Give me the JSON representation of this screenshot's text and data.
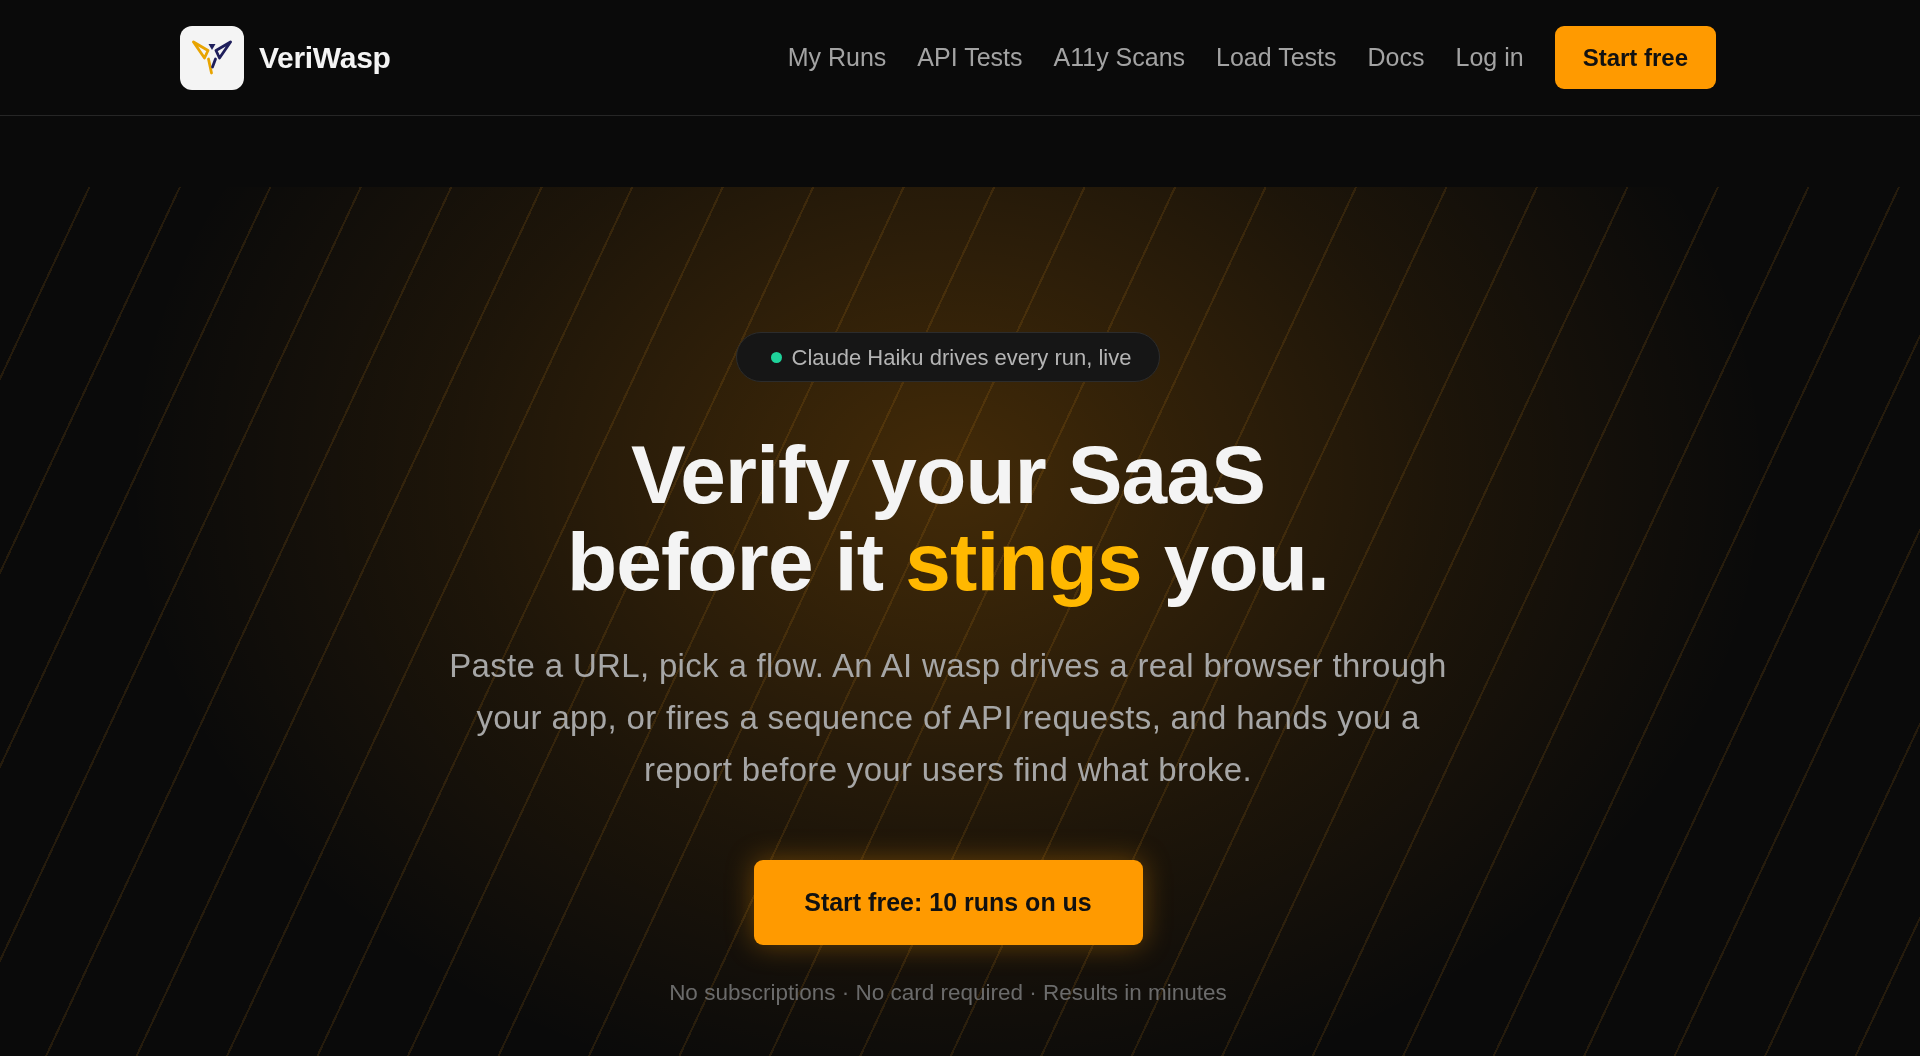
{
  "header": {
    "brand": "VeriWasp",
    "nav_links": [
      "My Runs",
      "API Tests",
      "A11y Scans",
      "Load Tests",
      "Docs",
      "Log in"
    ],
    "cta_button": "Start free"
  },
  "hero": {
    "badge": "Claude Haiku drives every run, live",
    "heading_lines": [
      [
        {
          "text": "Verify your SaaS",
          "kind": "plain"
        }
      ],
      [
        {
          "text": "before it",
          "kind": "plain"
        },
        {
          "text": "stings",
          "kind": "accent"
        },
        {
          "text": "you.",
          "kind": "plain"
        }
      ]
    ],
    "description": "Paste a URL, pick a flow. An AI wasp drives a real browser through your app, or fires a sequence of API requests, and hands you a report before your users find what broke.",
    "cta_button": "Start free: 10 runs on us",
    "note": "No subscriptions · No card required · Results in minutes"
  }
}
